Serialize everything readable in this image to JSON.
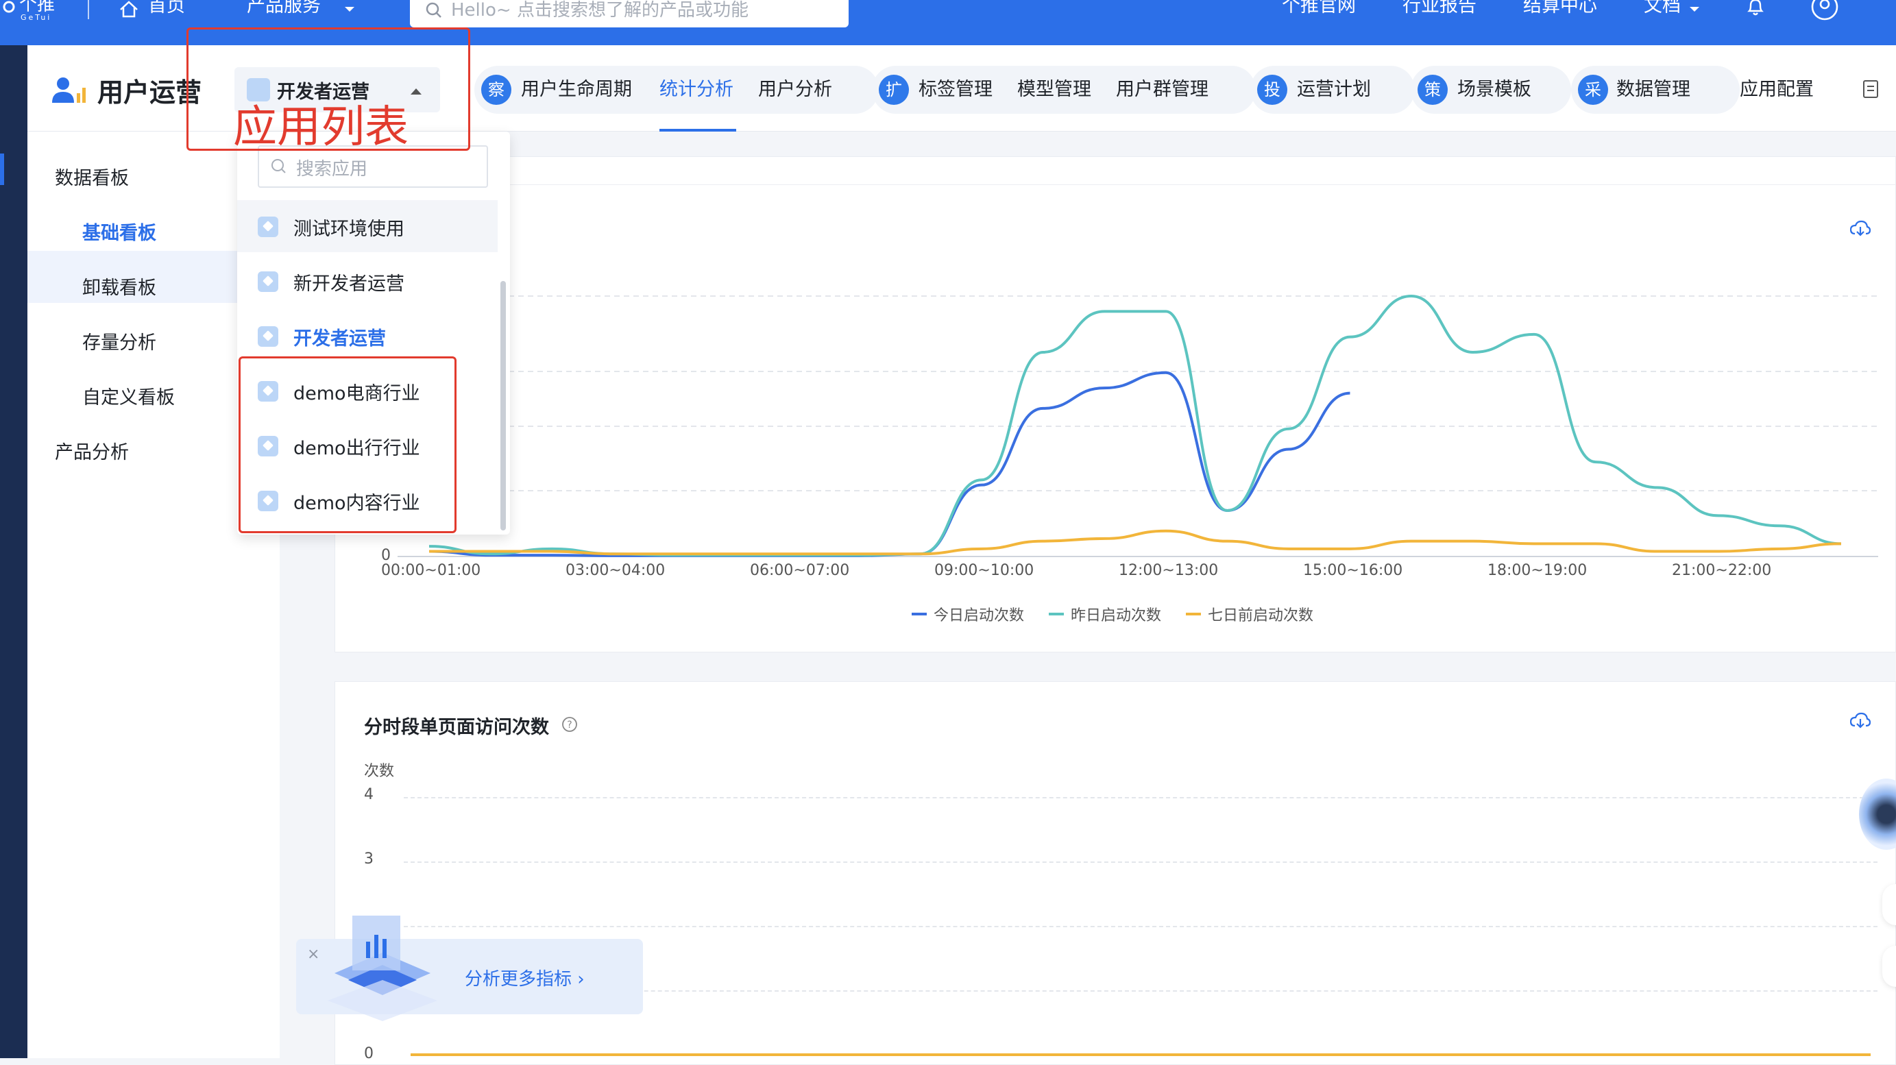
{
  "topnav": {
    "logo_text": "个推",
    "logo_sub": "GeTui",
    "home": "首页",
    "products": "产品服务",
    "search_placeholder": "Hello~ 点击搜索想了解的产品或功能",
    "links": [
      "个推官网",
      "行业报告",
      "结算中心",
      "文档"
    ]
  },
  "header": {
    "title": "用户运营",
    "app_selector": "开发者运营",
    "annotation_label": "应用列表",
    "groups": [
      {
        "badge": "察",
        "tabs": [
          "用户生命周期",
          "统计分析",
          "用户分析"
        ]
      },
      {
        "badge": "扩",
        "tabs": [
          "标签管理",
          "模型管理",
          "用户群管理"
        ]
      },
      {
        "badge": "投",
        "tabs": [
          "运营计划"
        ]
      },
      {
        "badge": "策",
        "tabs": [
          "场景模板"
        ]
      },
      {
        "badge": "采",
        "tabs": [
          "数据管理"
        ]
      }
    ],
    "app_config": "应用配置",
    "active_tab": "统计分析"
  },
  "sidebar": {
    "section1": "数据看板",
    "items": [
      "基础看板",
      "卸载看板",
      "存量分析",
      "自定义看板"
    ],
    "section2": "产品分析",
    "active": "基础看板"
  },
  "dropdown": {
    "search_placeholder": "搜索应用",
    "items": [
      "测试环境使用",
      "新开发者运营",
      "开发者运营",
      "demo电商行业",
      "demo出行行业",
      "demo内容行业"
    ],
    "selected": "开发者运营"
  },
  "chart_data": [
    {
      "type": "line",
      "x_ticks": [
        "00:00~01:00",
        "03:00~04:00",
        "06:00~07:00",
        "09:00~10:00",
        "12:00~13:00",
        "15:00~16:00",
        "18:00~19:00",
        "21:00~22:00"
      ],
      "y_tick_visible": "0",
      "series": [
        {
          "name": "今日启动次数",
          "color": "#3a6fe0",
          "values": [
            2,
            0.5,
            0.5,
            0.3,
            0.3,
            0.3,
            0.3,
            0.3,
            1,
            28,
            58,
            66,
            72,
            18,
            42,
            64
          ]
        },
        {
          "name": "昨日启动次数",
          "color": "#5cc4c0",
          "values": [
            4,
            1,
            3,
            1,
            0.5,
            0.5,
            0.5,
            0.5,
            1,
            30,
            80,
            96,
            96,
            18,
            50,
            86,
            102,
            80,
            87,
            37,
            27,
            16,
            12,
            5
          ]
        },
        {
          "name": "七日前启动次数",
          "color": "#f2b53a",
          "values": [
            2,
            2,
            2,
            1,
            1,
            1,
            1,
            1,
            1,
            3,
            6,
            7,
            10,
            6,
            3,
            3,
            6,
            6,
            5,
            5,
            2,
            2,
            3,
            5
          ]
        }
      ]
    },
    {
      "type": "line",
      "title": "分时段单页面访问次数",
      "ylabel": "次数",
      "y_ticks": [
        "4",
        "3",
        "0"
      ],
      "ylim": [
        0,
        4
      ],
      "series": [
        {
          "name": "",
          "color": "#f2b53a",
          "values": [
            0,
            0,
            0,
            0,
            0,
            0,
            0,
            0,
            0,
            0,
            0,
            0,
            0,
            0,
            0,
            0,
            0,
            0,
            0,
            0,
            0,
            0,
            0,
            0
          ]
        }
      ]
    }
  ],
  "promo": {
    "text": "分析更多指标 ›"
  }
}
